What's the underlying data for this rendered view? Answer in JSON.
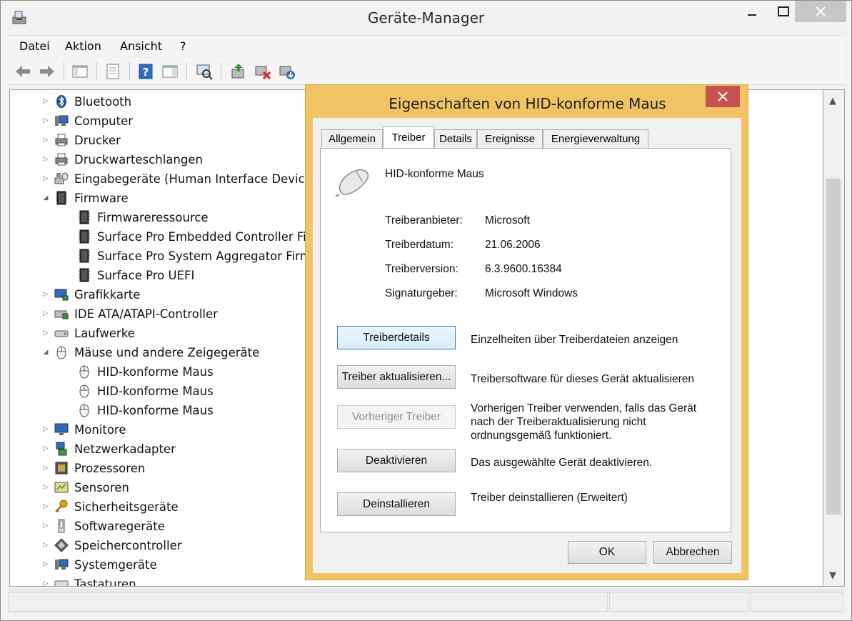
{
  "window": {
    "title": "Geräte-Manager",
    "close_color": "#c7c7c7"
  },
  "menu": {
    "items": [
      "Datei",
      "Aktion",
      "Ansicht",
      "?"
    ]
  },
  "toolbar": {
    "icons": [
      "back-arrow-icon",
      "forward-arrow-icon",
      "show-hide-console-tree-icon",
      "properties-icon",
      "help-icon",
      "action-pane-icon",
      "scan-hardware-icon",
      "update-driver-icon",
      "disable-device-icon",
      "uninstall-device-icon"
    ]
  },
  "tree": {
    "items": [
      {
        "label": "Bluetooth",
        "level": 0,
        "expander": "collapsed",
        "icon": "bluetooth-icon"
      },
      {
        "label": "Computer",
        "level": 0,
        "expander": "collapsed",
        "icon": "computer-icon"
      },
      {
        "label": "Drucker",
        "level": 0,
        "expander": "collapsed",
        "icon": "printer-icon"
      },
      {
        "label": "Druckwarteschlangen",
        "level": 0,
        "expander": "collapsed",
        "icon": "printer-icon"
      },
      {
        "label": "Eingabegeräte (Human Interface Devices",
        "level": 0,
        "expander": "collapsed",
        "icon": "hid-icon"
      },
      {
        "label": "Firmware",
        "level": 0,
        "expander": "expanded",
        "icon": "firmware-icon"
      },
      {
        "label": "Firmwareressource",
        "level": 1,
        "expander": "none",
        "icon": "firmware-icon"
      },
      {
        "label": "Surface Pro Embedded Controller Fir",
        "level": 1,
        "expander": "none",
        "icon": "firmware-icon"
      },
      {
        "label": "Surface Pro System Aggregator Firmw",
        "level": 1,
        "expander": "none",
        "icon": "firmware-icon"
      },
      {
        "label": "Surface Pro UEFI",
        "level": 1,
        "expander": "none",
        "icon": "firmware-icon"
      },
      {
        "label": "Grafikkarte",
        "level": 0,
        "expander": "collapsed",
        "icon": "display-adapter-icon"
      },
      {
        "label": "IDE ATA/ATAPI-Controller",
        "level": 0,
        "expander": "collapsed",
        "icon": "ide-controller-icon"
      },
      {
        "label": "Laufwerke",
        "level": 0,
        "expander": "collapsed",
        "icon": "disk-drive-icon"
      },
      {
        "label": "Mäuse und andere Zeigegeräte",
        "level": 0,
        "expander": "expanded",
        "icon": "mouse-icon"
      },
      {
        "label": "HID-konforme Maus",
        "level": 1,
        "expander": "none",
        "icon": "mouse-icon"
      },
      {
        "label": "HID-konforme Maus",
        "level": 1,
        "expander": "none",
        "icon": "mouse-icon"
      },
      {
        "label": "HID-konforme Maus",
        "level": 1,
        "expander": "none",
        "icon": "mouse-icon"
      },
      {
        "label": "Monitore",
        "level": 0,
        "expander": "collapsed",
        "icon": "monitor-icon"
      },
      {
        "label": "Netzwerkadapter",
        "level": 0,
        "expander": "collapsed",
        "icon": "network-adapter-icon"
      },
      {
        "label": "Prozessoren",
        "level": 0,
        "expander": "collapsed",
        "icon": "processor-icon"
      },
      {
        "label": "Sensoren",
        "level": 0,
        "expander": "collapsed",
        "icon": "sensor-icon"
      },
      {
        "label": "Sicherheitsgeräte",
        "level": 0,
        "expander": "collapsed",
        "icon": "security-key-icon"
      },
      {
        "label": "Softwaregeräte",
        "level": 0,
        "expander": "collapsed",
        "icon": "software-device-icon"
      },
      {
        "label": "Speichercontroller",
        "level": 0,
        "expander": "collapsed",
        "icon": "storage-controller-icon"
      },
      {
        "label": "Systemgeräte",
        "level": 0,
        "expander": "collapsed",
        "icon": "system-device-icon"
      },
      {
        "label": "Tastaturen",
        "level": 0,
        "expander": "collapsed",
        "icon": "keyboard-icon"
      }
    ]
  },
  "dialog": {
    "title": "Eigenschaften von HID-konforme Maus",
    "close_color": "#c75050",
    "frame_color": "#f0c464",
    "tabs": [
      "Allgemein",
      "Treiber",
      "Details",
      "Ereignisse",
      "Energieverwaltung"
    ],
    "active_tab": "Treiber",
    "device_name": "HID-konforme Maus",
    "fields": [
      {
        "label": "Treiberanbieter:",
        "value": "Microsoft"
      },
      {
        "label": "Treiberdatum:",
        "value": "21.06.2006"
      },
      {
        "label": "Treiberversion:",
        "value": "6.3.9600.16384"
      },
      {
        "label": "Signaturgeber:",
        "value": "Microsoft Windows"
      }
    ],
    "actions": [
      {
        "button": "Treiberdetails",
        "description": "Einzelheiten über Treiberdateien anzeigen",
        "enabled": true
      },
      {
        "button": "Treiber aktualisieren...",
        "description": "Treibersoftware für dieses Gerät aktualisieren",
        "enabled": true
      },
      {
        "button": "Vorheriger Treiber",
        "description": "Vorherigen Treiber verwenden, falls das Gerät nach der Treiberaktualisierung nicht ordnungsgemäß funktioniert.",
        "enabled": false
      },
      {
        "button": "Deaktivieren",
        "description": "Das ausgewählte Gerät deaktivieren.",
        "enabled": true
      },
      {
        "button": "Deinstallieren",
        "description": "Treiber deinstallieren (Erweitert)",
        "enabled": true
      }
    ],
    "ok_label": "OK",
    "cancel_label": "Abbrechen"
  }
}
